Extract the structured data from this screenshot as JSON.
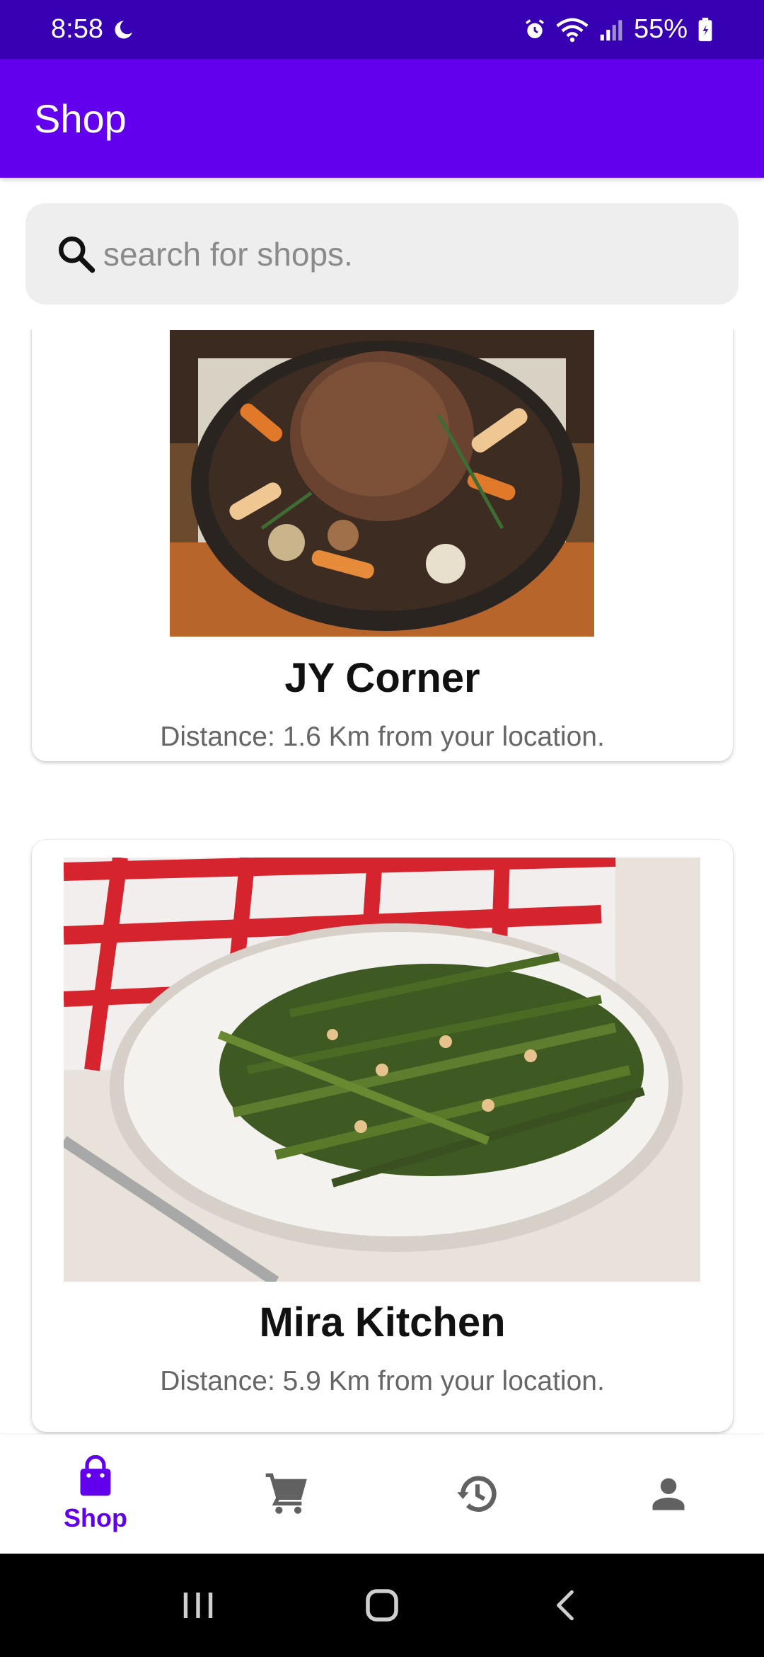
{
  "status_bar": {
    "time": "8:58",
    "battery": "55%",
    "icons": [
      "moon-icon",
      "alarm-icon",
      "wifi-icon",
      "signal-icon",
      "battery-icon"
    ]
  },
  "app_bar": {
    "title": "Shop"
  },
  "search": {
    "placeholder": "search for shops.",
    "value": "",
    "icon": "search-icon"
  },
  "shops": [
    {
      "name": "JY Corner",
      "distance": "Distance: 1.6 Km from your location.",
      "image": "roast-meat-with-vegetables-photo"
    },
    {
      "name": "Mira Kitchen",
      "distance": "Distance: 5.9 Km from your location.",
      "image": "grilled-green-beans-photo"
    }
  ],
  "bottom_nav": {
    "items": [
      {
        "id": "shop",
        "label": "Shop",
        "icon": "shopping-bag-icon",
        "active": true
      },
      {
        "id": "cart",
        "icon": "cart-icon",
        "active": false
      },
      {
        "id": "history",
        "icon": "history-icon",
        "active": false
      },
      {
        "id": "profile",
        "icon": "person-icon",
        "active": false
      }
    ]
  },
  "system_nav": [
    "recent-apps-icon",
    "home-icon",
    "back-icon"
  ],
  "colors": {
    "status_bar": "#3700b3",
    "primary": "#6200ee",
    "inactive_icon": "#616161",
    "search_bg": "#eeeeee"
  }
}
